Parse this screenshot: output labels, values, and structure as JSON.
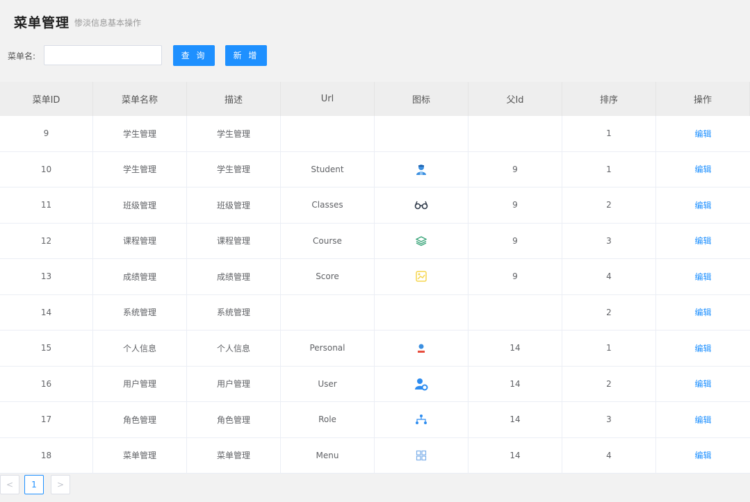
{
  "header": {
    "title": "菜单管理",
    "subtitle": "惨淡信息基本操作"
  },
  "search": {
    "label": "菜单名:",
    "value": "",
    "placeholder": "",
    "query_label": "查 询",
    "add_label": "新 增"
  },
  "table": {
    "columns": [
      "菜单ID",
      "菜单名称",
      "描述",
      "Url",
      "图标",
      "父Id",
      "排序",
      "操作"
    ],
    "rows": [
      {
        "id": "9",
        "name": "学生管理",
        "desc": "学生管理",
        "url": "",
        "icon": "",
        "parent": "",
        "sort": "1",
        "action": "编辑"
      },
      {
        "id": "10",
        "name": "学生管理",
        "desc": "学生管理",
        "url": "Student",
        "icon": "student-icon",
        "parent": "9",
        "sort": "1",
        "action": "编辑"
      },
      {
        "id": "11",
        "name": "班级管理",
        "desc": "班级管理",
        "url": "Classes",
        "icon": "glasses-icon",
        "parent": "9",
        "sort": "2",
        "action": "编辑"
      },
      {
        "id": "12",
        "name": "课程管理",
        "desc": "课程管理",
        "url": "Course",
        "icon": "layers-icon",
        "parent": "9",
        "sort": "3",
        "action": "编辑"
      },
      {
        "id": "13",
        "name": "成绩管理",
        "desc": "成绩管理",
        "url": "Score",
        "icon": "score-icon",
        "parent": "9",
        "sort": "4",
        "action": "编辑"
      },
      {
        "id": "14",
        "name": "系统管理",
        "desc": "系统管理",
        "url": "",
        "icon": "",
        "parent": "",
        "sort": "2",
        "action": "编辑"
      },
      {
        "id": "15",
        "name": "个人信息",
        "desc": "个人信息",
        "url": "Personal",
        "icon": "personal-icon",
        "parent": "14",
        "sort": "1",
        "action": "编辑"
      },
      {
        "id": "16",
        "name": "用户管理",
        "desc": "用户管理",
        "url": "User",
        "icon": "user-settings-icon",
        "parent": "14",
        "sort": "2",
        "action": "编辑"
      },
      {
        "id": "17",
        "name": "角色管理",
        "desc": "角色管理",
        "url": "Role",
        "icon": "hierarchy-icon",
        "parent": "14",
        "sort": "3",
        "action": "编辑"
      },
      {
        "id": "18",
        "name": "菜单管理",
        "desc": "菜单管理",
        "url": "Menu",
        "icon": "grid-icon",
        "parent": "14",
        "sort": "4",
        "action": "编辑"
      }
    ]
  },
  "pagination": {
    "prev": "<",
    "current": "1",
    "next": ">"
  },
  "colors": {
    "primary": "#1e90ff",
    "student_icon": "#3b8fe0",
    "glasses_icon": "#2f3a4a",
    "layers_icon": "#3aa57a",
    "score_icon": "#f5d64e",
    "personal_icon": "#3b8fe0",
    "user_icon": "#2d8cf0",
    "hierarchy_icon": "#2d8cf0",
    "grid_icon": "#7aaee8"
  }
}
